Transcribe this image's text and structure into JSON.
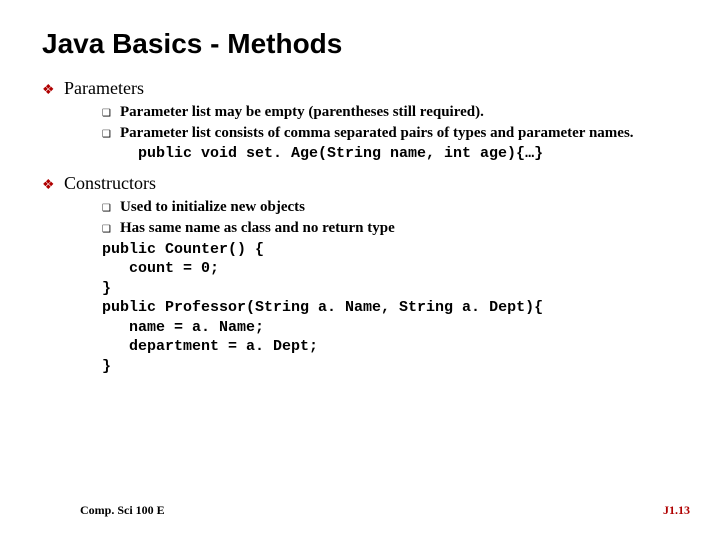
{
  "title": "Java Basics - Methods",
  "sections": [
    {
      "heading": "Parameters",
      "items": [
        "Parameter list may be empty (parentheses still required).",
        "Parameter list consists of comma separated pairs of types and parameter names."
      ],
      "code": "public void set. Age(String name, int age){…}"
    },
    {
      "heading": "Constructors",
      "items": [
        "Used to initialize new objects",
        "Has same name as class and no return type"
      ],
      "code": "public Counter() {\n   count = 0;\n}\npublic Professor(String a. Name, String a. Dept){\n   name = a. Name;\n   department = a. Dept;\n}"
    }
  ],
  "footer": {
    "left": "Comp. Sci 100 E",
    "right": "J1.13"
  }
}
